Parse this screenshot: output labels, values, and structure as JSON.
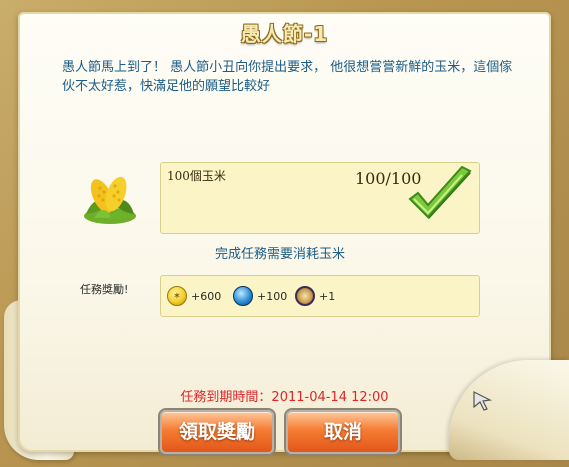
{
  "dialog": {
    "title": "愚人節-1",
    "description": "愚人節馬上到了！ 愚人節小丑向你提出要求， 他很想嘗嘗新鮮的玉米，這個傢伙不太好惹，快滿足他的願望比較好"
  },
  "requirement": {
    "item_name": "100個玉米",
    "progress": "100/100",
    "item_icon": "corn-icon",
    "status_icon": "check-icon",
    "consume_note": "完成任務需要消耗玉米"
  },
  "rewards": {
    "label": "任務獎勵!",
    "items": [
      {
        "icon": "coin-icon",
        "value": "+600"
      },
      {
        "icon": "gem-icon",
        "value": "+100"
      },
      {
        "icon": "badge-icon",
        "value": "+1"
      }
    ]
  },
  "expiry": "任務到期時間：2011-04-14 12:00",
  "buttons": {
    "claim": "領取獎勵",
    "cancel": "取消"
  },
  "colors": {
    "title": "#f7e9b2",
    "text_blue": "#1c5c86",
    "expiry_red": "#e0262a",
    "button_orange": "#f57d33",
    "panel_yellow": "#fbf4c6"
  }
}
